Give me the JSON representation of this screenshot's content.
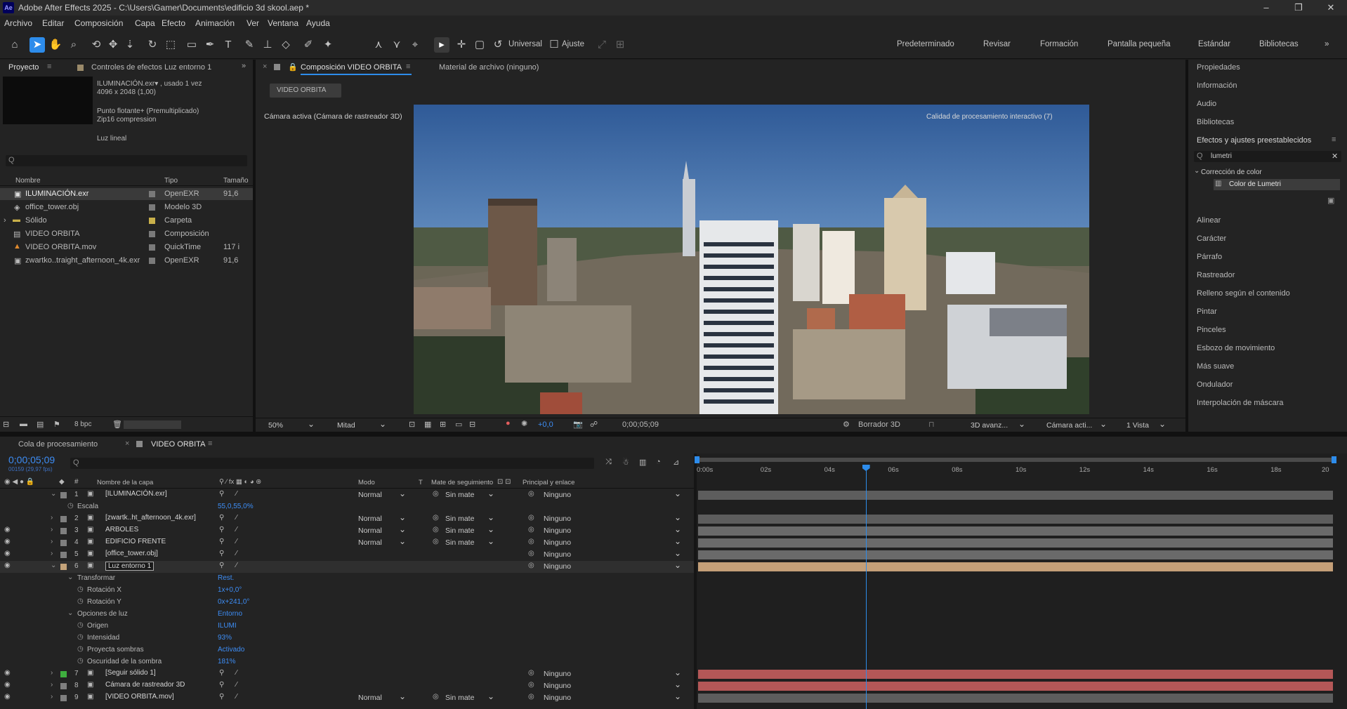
{
  "window": {
    "title": "Adobe After Effects 2025 - C:\\Users\\Gamer\\Documents\\edificio 3d skool.aep *",
    "logo": "Ae"
  },
  "window_controls": {
    "minimize": "–",
    "maximize": "❐",
    "close": "✕"
  },
  "menu": [
    "Archivo",
    "Editar",
    "Composición",
    "Capa",
    "Efecto",
    "Animación",
    "Ver",
    "Ventana",
    "Ayuda"
  ],
  "toolbar": {
    "universal_label": "Universal",
    "ajuste_label": "Ajuste",
    "workspaces": [
      "Predeterminado",
      "Revisar",
      "Formación",
      "Pantalla pequeña",
      "Estándar",
      "Bibliotecas"
    ],
    "more": "»"
  },
  "project_panel": {
    "tab": "Proyecto",
    "effects_tab": "Controles de efectos Luz entorno 1",
    "preview_info": [
      "ILUMINACIÓN.exr▾ , usado 1 vez",
      "4096 x 2048 (1,00)",
      "",
      "Punto flotante+ (Premultiplicado)",
      "Zip16 compression",
      "",
      "Luz lineal"
    ],
    "search_placeholder": "Q",
    "columns": {
      "name": "Nombre",
      "type": "Tipo",
      "size": "Tamaño"
    },
    "items": [
      {
        "name": "ILUMINACIÓN.exr",
        "type": "OpenEXR",
        "size": "91,6",
        "selected": true,
        "icon": "image-icon",
        "color": "#c8c8c8"
      },
      {
        "name": "office_tower.obj",
        "type": "Modelo 3D",
        "size": "",
        "icon": "model-3d-icon",
        "color": "#8a8a8a"
      },
      {
        "name": "Sólido",
        "type": "Carpeta",
        "size": "",
        "icon": "folder-icon",
        "color": "#c9b04a"
      },
      {
        "name": "VIDEO ORBITA",
        "type": "Composición",
        "size": "",
        "icon": "composition-icon",
        "color": "#c8c8c8"
      },
      {
        "name": "VIDEO ORBITA.mov",
        "type": "QuickTime",
        "size": "117 i",
        "icon": "cone-icon",
        "color": "#c8c8c8"
      },
      {
        "name": "zwartko..traight_afternoon_4k.exr",
        "type": "OpenEXR",
        "size": "91,6",
        "icon": "image-icon",
        "color": "#c8c8c8"
      }
    ],
    "bpc": "8 bpc"
  },
  "comp_panel": {
    "tab": "Composición VIDEO ORBITA",
    "footage_tab": "Material de archivo (ninguno)",
    "breadcrumb": "VIDEO ORBITA",
    "camera_label": "Cámara activa (Cámara de rastreador 3D)",
    "quality_label": "Calidad de procesamiento interactivo (7)",
    "zoom": "50%",
    "resolution": "Mitad",
    "exposure": "+0,0",
    "timecode": "0;00;05;09",
    "draft": "Borrador 3D",
    "renderer": "3D avanz...",
    "camera": "Cámara acti...",
    "views": "1 Vista"
  },
  "right_panel": {
    "items_top": [
      "Propiedades",
      "Información",
      "Audio",
      "Bibliotecas"
    ],
    "effects_title": "Efectos y ajustes preestablecidos",
    "search_value": "lumetri",
    "category": "Corrección de color",
    "effect": "Color de Lumetri",
    "items_bottom": [
      "Alinear",
      "Carácter",
      "Párrafo",
      "Rastreador",
      "Relleno según el contenido",
      "Pintar",
      "Pinceles",
      "Esbozo de movimiento",
      "Más suave",
      "Ondulador",
      "Interpolación de máscara"
    ]
  },
  "timeline": {
    "tabs": [
      "Cola de procesamiento",
      "VIDEO ORBITA"
    ],
    "timecode": "0;00;05;09",
    "timecode_sub": "00159 (29,97 fps)",
    "search_placeholder": "Q",
    "columns": {
      "name": "Nombre de la capa",
      "mode": "Modo",
      "t": "T",
      "track": "Mate de seguimiento",
      "parent": "Principal y enlace"
    },
    "ruler": [
      "0:00s",
      "02s",
      "04s",
      "06s",
      "08s",
      "10s",
      "12s",
      "14s",
      "16s",
      "18s",
      "20"
    ],
    "playhead_fraction": 0.265,
    "rows": [
      {
        "kind": "layer",
        "num": "1",
        "name": "[ILUMINACIÓN.exr]",
        "label_color": "#7f7f7f",
        "mode": "Normal",
        "track": "Sin mate",
        "parent": "Ninguno",
        "bar": "#5d5d5d",
        "eye": false,
        "expanded": true
      },
      {
        "kind": "prop",
        "indent": 1,
        "name": "Escala",
        "value": "55,0,55,0%"
      },
      {
        "kind": "layer",
        "num": "2",
        "name": "[zwartk..ht_afternoon_4k.exr]",
        "label_color": "#7f7f7f",
        "mode": "Normal",
        "track": "Sin mate",
        "parent": "Ninguno",
        "bar": "#5d5d5d",
        "eye": false
      },
      {
        "kind": "layer",
        "num": "3",
        "name": "ARBOLES",
        "label_color": "#7f7f7f",
        "mode": "Normal",
        "track": "Sin mate",
        "parent": "Ninguno",
        "bar": "#6a6a6a",
        "eye": true
      },
      {
        "kind": "layer",
        "num": "4",
        "name": "EDIFICIO FRENTE",
        "label_color": "#7f7f7f",
        "mode": "Normal",
        "track": "Sin mate",
        "parent": "Ninguno",
        "bar": "#6a6a6a",
        "eye": true
      },
      {
        "kind": "layer",
        "num": "5",
        "name": "[office_tower.obj]",
        "label_color": "#7f7f7f",
        "mode": "",
        "track": "",
        "parent": "Ninguno",
        "bar": "#6a6a6a",
        "eye": true
      },
      {
        "kind": "layer",
        "num": "6",
        "name": "Luz entorno 1",
        "label_color": "#c4a37a",
        "mode": "",
        "track": "",
        "parent": "Ninguno",
        "bar": "#c49f78",
        "eye": true,
        "selected": true,
        "expanded": true
      },
      {
        "kind": "group",
        "indent": 1,
        "name": "Transformar",
        "value": "Rest."
      },
      {
        "kind": "prop",
        "indent": 2,
        "name": "Rotación X",
        "value": "1x+0,0°"
      },
      {
        "kind": "prop",
        "indent": 2,
        "name": "Rotación Y",
        "value": "0x+241,0°"
      },
      {
        "kind": "group",
        "indent": 1,
        "name": "Opciones de luz",
        "value": "Entorno"
      },
      {
        "kind": "prop",
        "indent": 2,
        "name": "Origen",
        "value": "ILUMI"
      },
      {
        "kind": "prop",
        "indent": 2,
        "name": "Intensidad",
        "value": "93%"
      },
      {
        "kind": "prop",
        "indent": 2,
        "name": "Proyecta sombras",
        "value": "Activado"
      },
      {
        "kind": "prop",
        "indent": 2,
        "name": "Oscuridad de la sombra",
        "value": "181%"
      },
      {
        "kind": "layer",
        "num": "7",
        "name": "[Seguir sólido 1]",
        "label_color": "#3fae3f",
        "mode": "",
        "track": "",
        "parent": "Ninguno",
        "bar": "#b45757",
        "eye": true
      },
      {
        "kind": "layer",
        "num": "8",
        "name": "Cámara de rastreador 3D",
        "label_color": "#7f7f7f",
        "mode": "",
        "track": "",
        "parent": "Ninguno",
        "bar": "#b45757",
        "eye": true
      },
      {
        "kind": "layer",
        "num": "9",
        "name": "[VIDEO ORBITA.mov]",
        "label_color": "#7f7f7f",
        "mode": "Normal",
        "track": "Sin mate",
        "parent": "Ninguno",
        "bar": "#5d5d5d",
        "eye": true
      }
    ]
  },
  "colors": {
    "accent": "#2d8ceb",
    "blue_value": "#3d8df5",
    "panel": "#232323",
    "bg": "#1d1d1d"
  }
}
